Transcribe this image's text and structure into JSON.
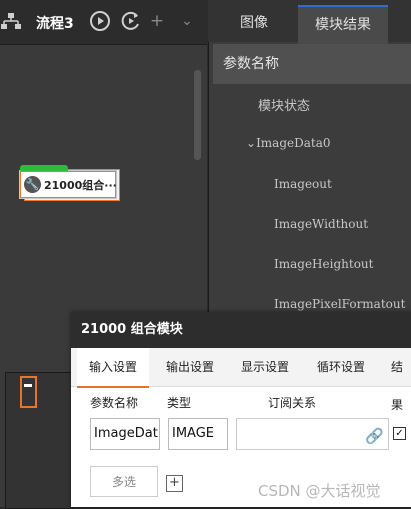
{
  "toolbar": {
    "flow_title": "流程3",
    "icons": [
      "sitemap-icon",
      "play-icon",
      "loop-play-icon",
      "plus-icon",
      "chevron-down-icon"
    ]
  },
  "canvas": {
    "node_label": "21000组合···"
  },
  "right_panel": {
    "tabs": [
      "图像",
      "模块结果"
    ],
    "param_header": "参数名称",
    "rows": [
      "模块状态",
      "ImageData0",
      "Imageout",
      "ImageWidthout",
      "ImageHeightout",
      "ImagePixelFormatout"
    ]
  },
  "dialog": {
    "title": "21000 组合模块",
    "tabs": [
      "输入设置",
      "输出设置",
      "显示设置",
      "循环设置",
      "结果"
    ],
    "col_param": "参数名称",
    "col_type": "类型",
    "col_sub": "订阅关系",
    "param_value": "ImageDat",
    "type_value": "IMAGE",
    "checkbox": "✓",
    "multi_select": "多选",
    "plus": "+"
  },
  "watermark": "CSDN @大话视觉",
  "colors": {
    "accent_orange": "#e8742a",
    "node_green": "#2dbb3c"
  }
}
